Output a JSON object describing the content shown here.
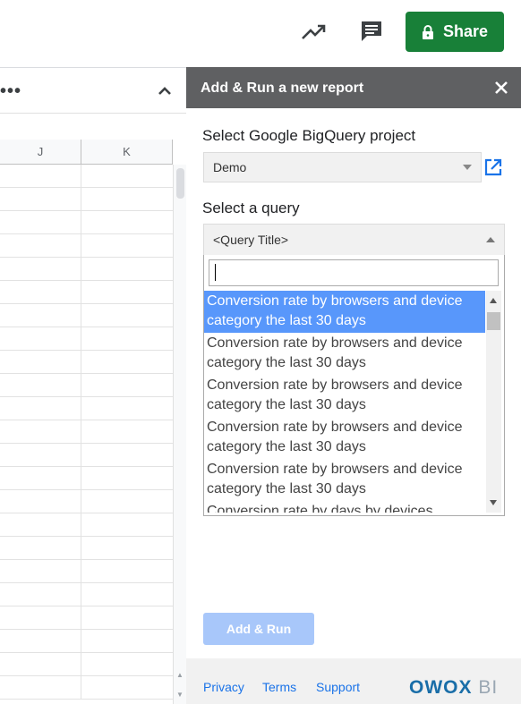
{
  "topbar": {
    "share_label": "Share",
    "icons": [
      "trending-up-icon",
      "comment-icon",
      "lock-icon"
    ]
  },
  "sheet": {
    "columns": [
      "J",
      "K"
    ]
  },
  "panel": {
    "title": "Add & Run a new report",
    "project_label": "Select Google BigQuery project",
    "project_value": "Demo",
    "query_label": "Select a query",
    "query_value": "<Query Title>",
    "search_value": "",
    "options": [
      "Conversion rate by browsers and device category the last 30 days",
      "Conversion rate by browsers and device category the last 30 days",
      "Conversion rate by browsers and device category the last 30 days",
      "Conversion rate by browsers and device category the last 30 days",
      "Conversion rate by browsers and device category the last 30 days",
      "Conversion rate by days by devices"
    ],
    "add_run_label": "Add & Run",
    "footer": {
      "privacy": "Privacy",
      "terms": "Terms",
      "support": "Support",
      "brand": "OWOX",
      "brand_suffix": "BI"
    },
    "colors": {
      "header_bg": "#5f6062",
      "highlight": "#5897fb",
      "share_green": "#188038",
      "link_blue": "#1a73e8"
    }
  }
}
